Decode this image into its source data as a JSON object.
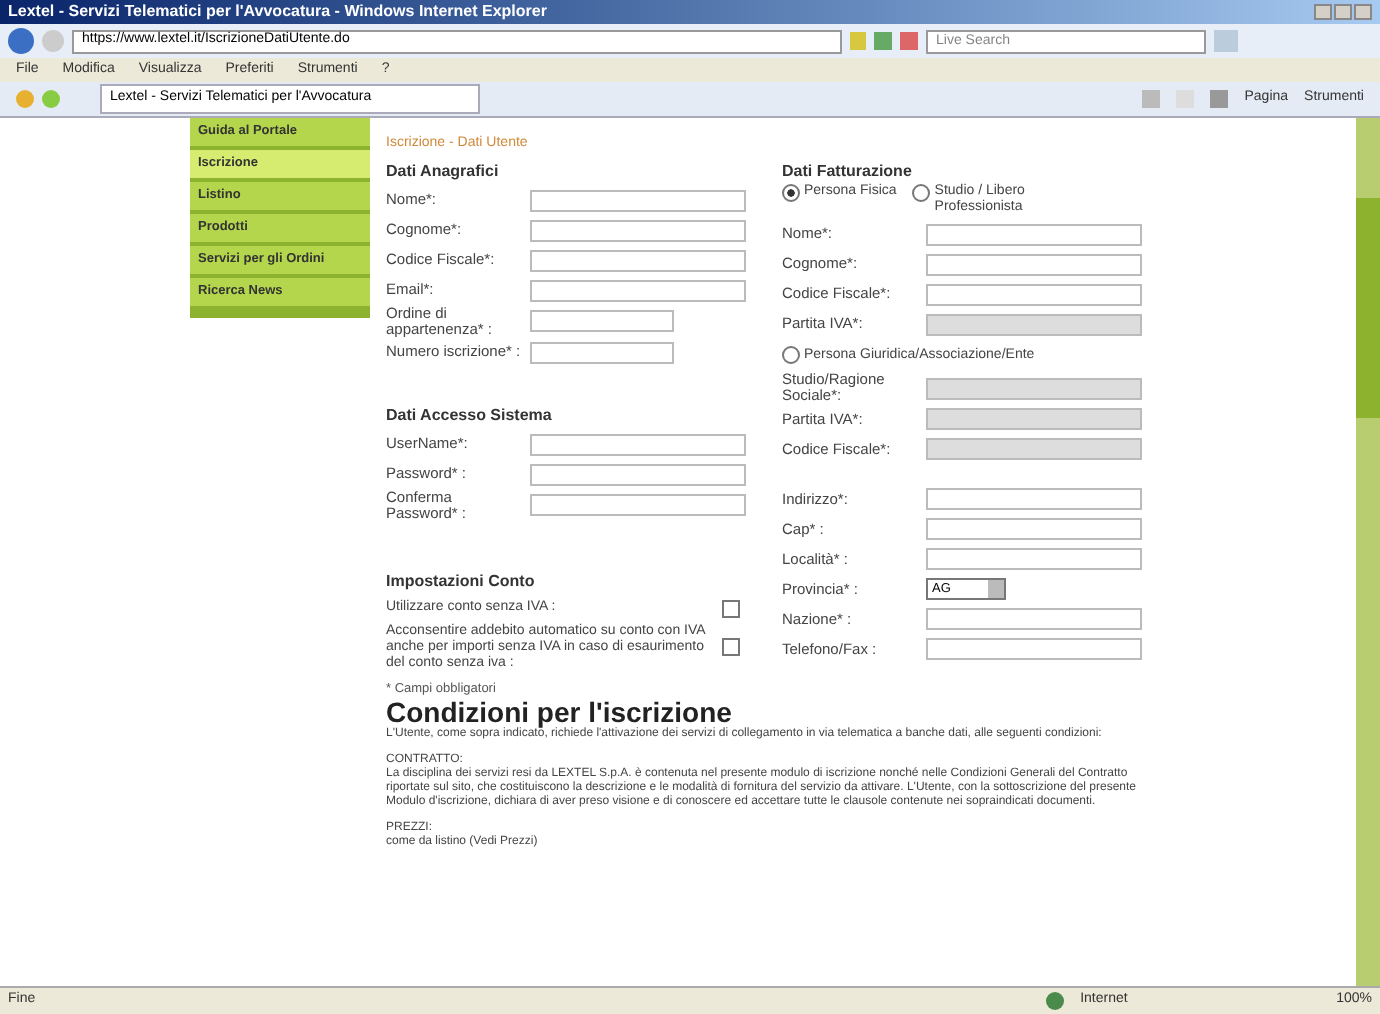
{
  "window": {
    "title": "Lextel - Servizi Telematici per l'Avvocatura - Windows Internet Explorer"
  },
  "address_bar": {
    "url": "https://www.lextel.it/IscrizioneDatiUtente.do"
  },
  "search": {
    "placeholder": "Live Search"
  },
  "menu": [
    "File",
    "Modifica",
    "Visualizza",
    "Preferiti",
    "Strumenti",
    "?"
  ],
  "tab": {
    "label": "Lextel - Servizi Telematici per l'Avvocatura"
  },
  "command_bar": [
    "Pagina",
    "Strumenti"
  ],
  "sidebar": {
    "items": [
      {
        "label": "Guida al Portale",
        "selected": false
      },
      {
        "label": "Iscrizione",
        "selected": true
      },
      {
        "label": "Listino",
        "selected": false
      },
      {
        "label": "Prodotti",
        "selected": false
      },
      {
        "label": "Servizi per gli Ordini",
        "selected": false
      },
      {
        "label": "Ricerca News",
        "selected": false
      }
    ]
  },
  "breadcrumb": "Iscrizione - Dati Utente",
  "left_sections": [
    {
      "title": "Dati Anagrafici",
      "fields": [
        {
          "label": "Nome*:",
          "short": false
        },
        {
          "label": "Cognome*:",
          "short": false
        },
        {
          "label": "Codice Fiscale*:",
          "short": false
        },
        {
          "label": "Email*:",
          "short": false
        },
        {
          "label": "Ordine di appartenenza* :",
          "short": true
        },
        {
          "label": "Numero iscrizione* :",
          "short": true
        }
      ]
    },
    {
      "title": "Dati Accesso Sistema",
      "fields": [
        {
          "label": "UserName*:",
          "short": false
        },
        {
          "label": "Password* :",
          "short": false
        },
        {
          "label": "Conferma Password* :",
          "short": false
        }
      ]
    }
  ],
  "billing": {
    "title": "Dati Fatturazione",
    "radios": [
      {
        "label": "Persona Fisica",
        "selected": true
      },
      {
        "label": "Studio / Libero Professionista",
        "selected": false
      }
    ],
    "fields": [
      {
        "kind": "text",
        "label": "Nome*:",
        "disabled": false
      },
      {
        "kind": "text",
        "label": "Cognome*:",
        "disabled": false
      },
      {
        "kind": "text",
        "label": "Codice Fiscale*:",
        "disabled": false
      },
      {
        "kind": "text",
        "label": "Partita IVA*:",
        "disabled": true
      },
      {
        "kind": "radio",
        "label": "Persona Giuridica/Associazione/Ente",
        "selected": false
      },
      {
        "kind": "text",
        "label": "Studio/Ragione Sociale*:",
        "disabled": true
      },
      {
        "kind": "text",
        "label": "Partita IVA*:",
        "disabled": true
      },
      {
        "kind": "text",
        "label": "Codice Fiscale*:",
        "disabled": true
      },
      {
        "kind": "spacer"
      },
      {
        "kind": "text",
        "label": "Indirizzo*:",
        "disabled": false
      },
      {
        "kind": "text",
        "label": "Cap* :",
        "disabled": false
      },
      {
        "kind": "text",
        "label": "Località* :",
        "disabled": false
      },
      {
        "kind": "select",
        "label": "Provincia* :",
        "value": "AG"
      },
      {
        "kind": "text",
        "label": "Nazione* :",
        "disabled": false
      },
      {
        "kind": "text",
        "label": "Telefono/Fax :",
        "disabled": false
      }
    ]
  },
  "account_settings": {
    "title": "Impostazioni Conto",
    "options": [
      {
        "label": "Utilizzare conto senza IVA :",
        "checked": false
      },
      {
        "label": "Acconsentire addebito automatico su conto con IVA anche per importi senza IVA in caso di esaurimento del conto senza iva :",
        "checked": false
      }
    ]
  },
  "required_note": "* Campi obbligatori",
  "conditions": {
    "title": "Condizioni per l'iscrizione",
    "intro": "L'Utente, come sopra indicato, richiede l'attivazione dei servizi di collegamento in via telematica a banche dati, alle seguenti condizioni:",
    "sections": [
      {
        "heading": "CONTRATTO:",
        "text": "La disciplina dei servizi resi da LEXTEL S.p.A. è contenuta nel presente modulo di iscrizione nonché nelle Condizioni Generali del Contratto riportate sul sito, che costituiscono la descrizione e le modalità di fornitura del servizio da attivare. L'Utente, con la sottoscrizione del presente Modulo d'iscrizione, dichiara di aver preso visione e di conoscere ed accettare tutte le clausole contenute nei sopraindicati documenti."
      },
      {
        "heading": "PREZZI:",
        "text": "come da listino (Vedi Prezzi)"
      }
    ]
  },
  "status_bar": {
    "text": "Fine",
    "zone": "Internet",
    "zoom": "100%"
  }
}
